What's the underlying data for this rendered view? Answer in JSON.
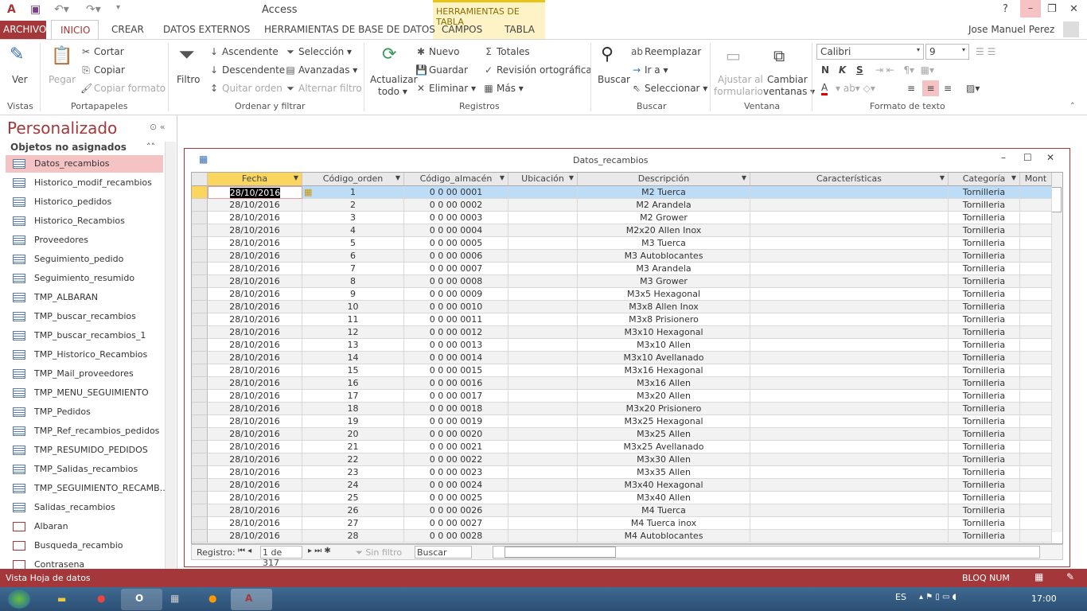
{
  "app": {
    "title": "Access",
    "context_tab_group": "HERRAMIENTAS DE TABLA",
    "user": "Jose Manuel Perez",
    "help": "?"
  },
  "tabs": [
    "ARCHIVO",
    "INICIO",
    "CREAR",
    "DATOS EXTERNOS",
    "HERRAMIENTAS DE BASE DE DATOS",
    "CAMPOS",
    "TABLA"
  ],
  "ribbon": {
    "vistas": {
      "ver": "Ver",
      "label": "Vistas"
    },
    "portapapeles": {
      "pegar": "Pegar",
      "cortar": "Cortar",
      "copiar": "Copiar",
      "copiar_formato": "Copiar formato",
      "label": "Portapapeles"
    },
    "ordenar": {
      "filtro": "Filtro",
      "ascendente": "Ascendente",
      "descendente": "Descendente",
      "quitar_orden": "Quitar orden",
      "seleccion": "Selección",
      "avanzadas": "Avanzadas",
      "alternar": "Alternar filtro",
      "label": "Ordenar y filtrar"
    },
    "registros": {
      "actualizar": "Actualizar",
      "todo": "todo",
      "nuevo": "Nuevo",
      "guardar": "Guardar",
      "eliminar": "Eliminar",
      "totales": "Totales",
      "revision": "Revisión ortográfica",
      "mas": "Más",
      "label": "Registros"
    },
    "buscar": {
      "buscar": "Buscar",
      "reemplazar": "Reemplazar",
      "ir_a": "Ir a",
      "seleccionar": "Seleccionar",
      "label": "Buscar"
    },
    "ventana": {
      "ajustar1": "Ajustar al",
      "ajustar2": "formulario",
      "cambiar1": "Cambiar",
      "cambiar2": "ventanas",
      "label": "Ventana"
    },
    "formato": {
      "font": "Calibri",
      "size": "9",
      "bold": "N",
      "italic": "K",
      "underline": "S",
      "label": "Formato de texto",
      "font_color": "#e00000"
    }
  },
  "nav": {
    "title": "Personalizado",
    "group": "Objetos no asignados",
    "items": [
      {
        "label": "Datos_recambios",
        "type": "table",
        "selected": true
      },
      {
        "label": "Historico_modif_recambios",
        "type": "table"
      },
      {
        "label": "Historico_pedidos",
        "type": "table"
      },
      {
        "label": "Historico_Recambios",
        "type": "table"
      },
      {
        "label": "Proveedores",
        "type": "table"
      },
      {
        "label": "Seguimiento_pedido",
        "type": "table"
      },
      {
        "label": "Seguimiento_resumido",
        "type": "table"
      },
      {
        "label": "TMP_ALBARAN",
        "type": "table"
      },
      {
        "label": "TMP_buscar_recambios",
        "type": "table"
      },
      {
        "label": "TMP_buscar_recambios_1",
        "type": "table"
      },
      {
        "label": "TMP_Historico_Recambios",
        "type": "table"
      },
      {
        "label": "TMP_Mail_proveedores",
        "type": "table"
      },
      {
        "label": "TMP_MENU_SEGUIMIENTO",
        "type": "table"
      },
      {
        "label": "TMP_Pedidos",
        "type": "table"
      },
      {
        "label": "TMP_Ref_recambios_pedidos",
        "type": "table"
      },
      {
        "label": "TMP_RESUMIDO_PEDIDOS",
        "type": "table"
      },
      {
        "label": "TMP_Salidas_recambios",
        "type": "table"
      },
      {
        "label": "TMP_SEGUIMIENTO_RECAMB...",
        "type": "table"
      },
      {
        "label": "Salidas_recambios",
        "type": "table"
      },
      {
        "label": "Albaran",
        "type": "form"
      },
      {
        "label": "Busqueda_recambio",
        "type": "form"
      },
      {
        "label": "Contrasena",
        "type": "form"
      }
    ]
  },
  "datasheet": {
    "title": "Datos_recambios",
    "columns": [
      "Fecha",
      "Código_orden",
      "Código_almacén",
      "Ubicación",
      "Descripción",
      "Características",
      "Categoría",
      "Mont"
    ],
    "rows": [
      [
        "28/10/2016",
        "1",
        "0 0 00 0001",
        "",
        "M2 Tuerca",
        "",
        "Tornilleria",
        ""
      ],
      [
        "28/10/2016",
        "2",
        "0 0 00 0002",
        "",
        "M2 Arandela",
        "",
        "Tornilleria",
        ""
      ],
      [
        "28/10/2016",
        "3",
        "0 0 00 0003",
        "",
        "M2 Grower",
        "",
        "Tornilleria",
        ""
      ],
      [
        "28/10/2016",
        "4",
        "0 0 00 0004",
        "",
        "M2x20 Allen Inox",
        "",
        "Tornilleria",
        ""
      ],
      [
        "28/10/2016",
        "5",
        "0 0 00 0005",
        "",
        "M3 Tuerca",
        "",
        "Tornilleria",
        ""
      ],
      [
        "28/10/2016",
        "6",
        "0 0 00 0006",
        "",
        "M3 Autoblocantes",
        "",
        "Tornilleria",
        ""
      ],
      [
        "28/10/2016",
        "7",
        "0 0 00 0007",
        "",
        "M3 Arandela",
        "",
        "Tornilleria",
        ""
      ],
      [
        "28/10/2016",
        "8",
        "0 0 00 0008",
        "",
        "M3 Grower",
        "",
        "Tornilleria",
        ""
      ],
      [
        "28/10/2016",
        "9",
        "0 0 00 0009",
        "",
        "M3x5 Hexagonal",
        "",
        "Tornilleria",
        ""
      ],
      [
        "28/10/2016",
        "10",
        "0 0 00 0010",
        "",
        "M3x8 Allen Inox",
        "",
        "Tornilleria",
        ""
      ],
      [
        "28/10/2016",
        "11",
        "0 0 00 0011",
        "",
        "M3x8 Prisionero",
        "",
        "Tornilleria",
        ""
      ],
      [
        "28/10/2016",
        "12",
        "0 0 00 0012",
        "",
        "M3x10 Hexagonal",
        "",
        "Tornilleria",
        ""
      ],
      [
        "28/10/2016",
        "13",
        "0 0 00 0013",
        "",
        "M3x10 Allen",
        "",
        "Tornilleria",
        ""
      ],
      [
        "28/10/2016",
        "14",
        "0 0 00 0014",
        "",
        "M3x10 Avellanado",
        "",
        "Tornilleria",
        ""
      ],
      [
        "28/10/2016",
        "15",
        "0 0 00 0015",
        "",
        "M3x16 Hexagonal",
        "",
        "Tornilleria",
        ""
      ],
      [
        "28/10/2016",
        "16",
        "0 0 00 0016",
        "",
        "M3x16 Allen",
        "",
        "Tornilleria",
        ""
      ],
      [
        "28/10/2016",
        "17",
        "0 0 00 0017",
        "",
        "M3x20 Allen",
        "",
        "Tornilleria",
        ""
      ],
      [
        "28/10/2016",
        "18",
        "0 0 00 0018",
        "",
        "M3x20 Prisionero",
        "",
        "Tornilleria",
        ""
      ],
      [
        "28/10/2016",
        "19",
        "0 0 00 0019",
        "",
        "M3x25 Hexagonal",
        "",
        "Tornilleria",
        ""
      ],
      [
        "28/10/2016",
        "20",
        "0 0 00 0020",
        "",
        "M3x25 Allen",
        "",
        "Tornilleria",
        ""
      ],
      [
        "28/10/2016",
        "21",
        "0 0 00 0021",
        "",
        "M3x25 Avellanado",
        "",
        "Tornilleria",
        ""
      ],
      [
        "28/10/2016",
        "22",
        "0 0 00 0022",
        "",
        "M3x30 Allen",
        "",
        "Tornilleria",
        ""
      ],
      [
        "28/10/2016",
        "23",
        "0 0 00 0023",
        "",
        "M3x35 Allen",
        "",
        "Tornilleria",
        ""
      ],
      [
        "28/10/2016",
        "24",
        "0 0 00 0024",
        "",
        "M3x40 Hexagonal",
        "",
        "Tornilleria",
        ""
      ],
      [
        "28/10/2016",
        "25",
        "0 0 00 0025",
        "",
        "M3x40 Allen",
        "",
        "Tornilleria",
        ""
      ],
      [
        "28/10/2016",
        "26",
        "0 0 00 0026",
        "",
        "M4 Tuerca",
        "",
        "Tornilleria",
        ""
      ],
      [
        "28/10/2016",
        "27",
        "0 0 00 0027",
        "",
        "M4 Tuerca inox",
        "",
        "Tornilleria",
        ""
      ],
      [
        "28/10/2016",
        "28",
        "0 0 00 0028",
        "",
        "M4 Autoblocantes",
        "",
        "Tornilleria",
        ""
      ]
    ],
    "navbar": {
      "label": "Registro:",
      "position": "1 de 317",
      "filter": "Sin filtro",
      "search": "Buscar"
    }
  },
  "status": {
    "left": "Vista Hoja de datos",
    "numlock": "BLOQ NUM"
  },
  "taskbar": {
    "lang": "ES",
    "time": "17:00"
  }
}
